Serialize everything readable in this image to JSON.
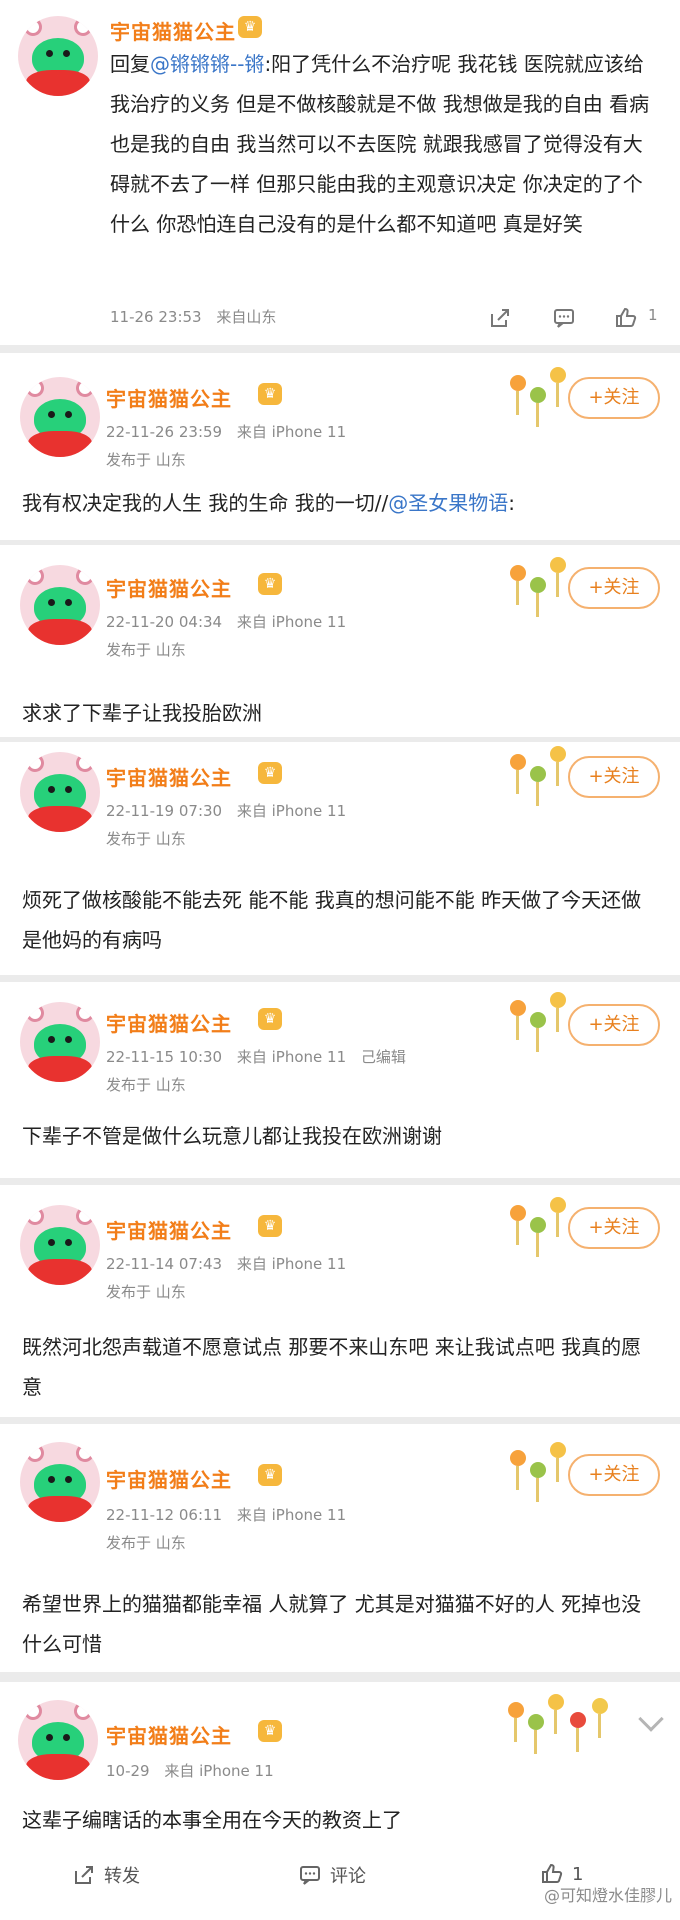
{
  "reply": {
    "user": "宇宙猫猫公主",
    "vip_icon": "crown-icon",
    "reply_prefix": "回复",
    "mention": "@锵锵锵--锵",
    "text": ":阳了凭什么不治疗呢 我花钱 医院就应该给我治疗的义务 但是不做核酸就是不做 我想做是我的自由 看病也是我的自由 我当然可以不去医院 就跟我感冒了觉得没有大碍就不去了一样 但那只能由我的主观意识决定 你决定的了个什么 你恐怕连自己没有的是什么都不知道吧 真是好笑",
    "time": "11-26 23:53",
    "source": "来自山东",
    "like_count": "1"
  },
  "follow_label": "+关注",
  "posts": [
    {
      "user": "宇宙猫猫公主",
      "date": "22-11-26 23:59",
      "device": "来自 iPhone 11",
      "edited": "",
      "location": "发布于 山东",
      "text": "我有权决定我的人生 我的生命 我的一切//",
      "mention": "@圣女果物语",
      "mention_suffix": ":"
    },
    {
      "user": "宇宙猫猫公主",
      "date": "22-11-20 04:34",
      "device": "来自 iPhone 11",
      "edited": "",
      "location": "发布于 山东",
      "text": "求求了下辈子让我投胎欧洲"
    },
    {
      "user": "宇宙猫猫公主",
      "date": "22-11-19 07:30",
      "device": "来自 iPhone 11",
      "edited": "",
      "location": "发布于 山东",
      "text": "烦死了做核酸能不能去死 能不能 我真的想问能不能 昨天做了今天还做 是他妈的有病吗"
    },
    {
      "user": "宇宙猫猫公主",
      "date": "22-11-15 10:30",
      "device": "来自 iPhone 11",
      "edited": "己编辑",
      "location": "发布于 山东",
      "text": "下辈子不管是做什么玩意儿都让我投在欧洲谢谢"
    },
    {
      "user": "宇宙猫猫公主",
      "date": "22-11-14 07:43",
      "device": "来自 iPhone 11",
      "edited": "",
      "location": "发布于 山东",
      "text": "既然河北怨声载道不愿意试点 那要不来山东吧 来让我试点吧 我真的愿意"
    },
    {
      "user": "宇宙猫猫公主",
      "date": "22-11-12 06:11",
      "device": "来自 iPhone 11",
      "edited": "",
      "location": "发布于 山东",
      "text": "希望世界上的猫猫都能幸福 人就算了 尤其是对猫猫不好的人 死掉也没什么可惜"
    }
  ],
  "last_post": {
    "user": "宇宙猫猫公主",
    "date": "10-29",
    "device": "来自 iPhone 11",
    "text": "这辈子编瞎话的本事全用在今天的教资上了",
    "repost_label": "转发",
    "comment_label": "评论",
    "like_count": "1"
  },
  "watermark": "@可知燈水佳膠儿",
  "colors": {
    "username": "#f27e19",
    "mention": "#3a76c8",
    "follow_border": "#f5b16f",
    "background": "#ebebeb"
  }
}
